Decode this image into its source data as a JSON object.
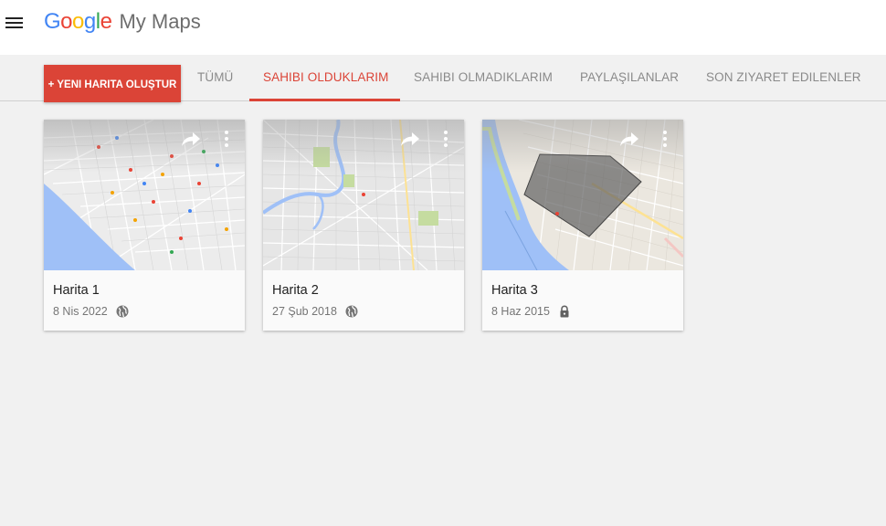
{
  "header": {
    "brand_google": "Google",
    "brand_product": "My Maps",
    "menu_icon": "hamburger-menu-icon"
  },
  "create_button": {
    "label": "+ YENI HARITA OLUŞTUR"
  },
  "tabs": [
    {
      "label": "TÜMÜ",
      "active": false
    },
    {
      "label": "SAHIBI OLDUKLARIM",
      "active": true
    },
    {
      "label": "SAHIBI OLMADIKLARIM",
      "active": false
    },
    {
      "label": "PAYLAŞILANLAR",
      "active": false
    },
    {
      "label": "SON ZIYARET EDILENLER",
      "active": false
    }
  ],
  "maps": [
    {
      "title": "Harita 1",
      "date": "8 Nis 2022",
      "visibility_icon": "globe-icon"
    },
    {
      "title": "Harita 2",
      "date": "27 Şub 2018",
      "visibility_icon": "globe-icon"
    },
    {
      "title": "Harita 3",
      "date": "8 Haz 2015",
      "visibility_icon": "lock-icon"
    }
  ],
  "colors": {
    "accent": "#db4437",
    "tab_inactive": "#8a8a8a",
    "background": "#f1f1f1",
    "map_water": "#9fc0f7",
    "map_land": "#e8e8e8"
  }
}
